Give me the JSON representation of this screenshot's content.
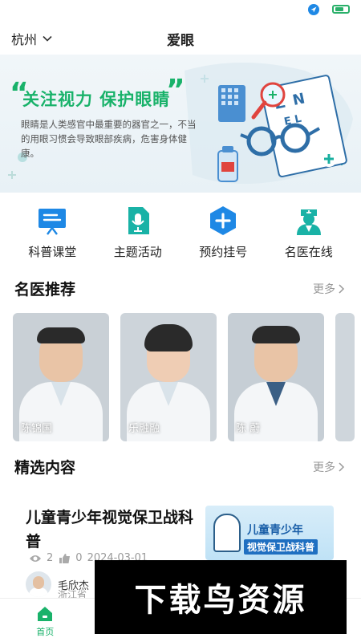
{
  "header": {
    "city": "杭州",
    "title": "爱眼"
  },
  "banner": {
    "slogan": "关注视力 保护眼睛",
    "description": "眼睛是人类感官中最重要的器官之一，不当的用眼习惯会导致眼部疾病，危害身体健康。"
  },
  "quick_nav": [
    {
      "label": "科普课堂",
      "icon": "blackboard-icon"
    },
    {
      "label": "主题活动",
      "icon": "microphone-doc-icon"
    },
    {
      "label": "预约挂号",
      "icon": "plus-hexagon-icon"
    },
    {
      "label": "名医在线",
      "icon": "doctor-icon"
    }
  ],
  "doctors_section": {
    "title": "名医推荐",
    "more": "更多",
    "doctors": [
      {
        "name": "陈锦国"
      },
      {
        "name": "乐融融"
      },
      {
        "name": "陈 蔚"
      }
    ]
  },
  "content_section": {
    "title": "精选内容",
    "more": "更多",
    "article": {
      "title": "儿童青少年视觉保卫战科普",
      "image_title": "儿童青少年",
      "image_subtitle": "视觉保卫战科普",
      "views": "2",
      "likes": "0",
      "date": "2024-03-01",
      "author": "毛欣杰",
      "hospital": "浙江省"
    }
  },
  "tabbar": {
    "home": "首页"
  },
  "watermark": "下载鸟资源",
  "colors": {
    "accent": "#19b26a",
    "nav_blue": "#1e88e5",
    "nav_teal": "#19b2a6"
  }
}
